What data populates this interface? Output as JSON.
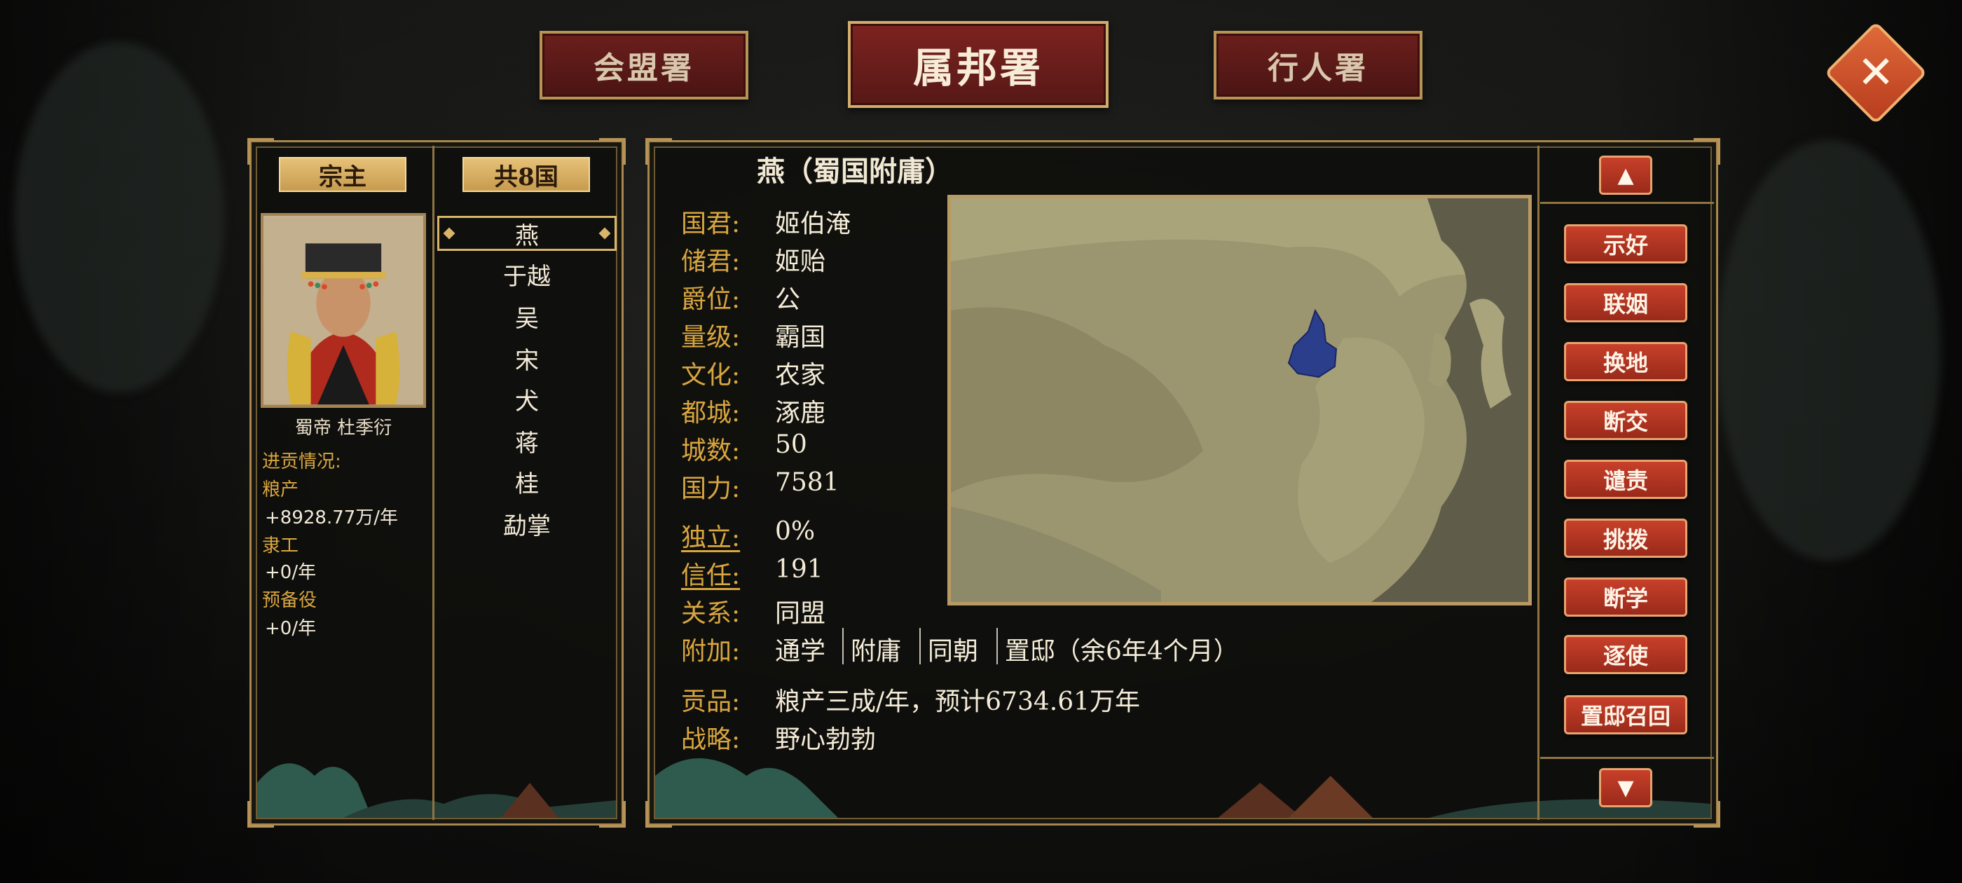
{
  "tabs": {
    "left": "会盟署",
    "center": "属邦署",
    "right": "行人署"
  },
  "close_icon": "close-x-icon",
  "left_panel": {
    "suzerain_label": "宗主",
    "count_label": "共8国",
    "lord_name": "蜀帝 杜季衍",
    "tribute_title": "进贡情况:",
    "grain_label": "粮产",
    "grain_value": "+8928.77万/年",
    "labor_label": "隶工",
    "labor_value": "+0/年",
    "reserve_label": "预备役",
    "reserve_value": "+0/年"
  },
  "nations": [
    "燕",
    "于越",
    "吴",
    "宋",
    "犬",
    "蒋",
    "桂",
    "勐掌"
  ],
  "selected_nation": "燕",
  "detail": {
    "title": "燕（蜀国附庸）",
    "rows": [
      {
        "label": "国君:",
        "value": "姬伯淹"
      },
      {
        "label": "储君:",
        "value": "姬贻"
      },
      {
        "label": "爵位:",
        "value": "公"
      },
      {
        "label": "量级:",
        "value": "霸国"
      },
      {
        "label": "文化:",
        "value": "农家"
      },
      {
        "label": "都城:",
        "value": "涿鹿"
      },
      {
        "label": "城数:",
        "value": "50"
      },
      {
        "label": "国力:",
        "value": "7581"
      },
      {
        "label": "独立:",
        "value": "0%"
      },
      {
        "label": "信任:",
        "value": "191"
      },
      {
        "label": "关系:",
        "value": "同盟"
      }
    ],
    "extra_label": "附加:",
    "extra_items": [
      "通学",
      "附庸",
      "同朝",
      "置邸（余6年4个月）"
    ],
    "tribute_label": "贡品:",
    "tribute_value": "粮产三成/年，预计6734.61万年",
    "strategy_label": "战略:",
    "strategy_value": "野心勃勃"
  },
  "actions": [
    "示好",
    "联姻",
    "换地",
    "断交",
    "谴责",
    "挑拨",
    "断学",
    "逐使",
    "置邸召回"
  ],
  "colors": {
    "gold": "#d9a63f",
    "button_red": "#b8341f",
    "highlight_region": "#2b3e8c"
  }
}
